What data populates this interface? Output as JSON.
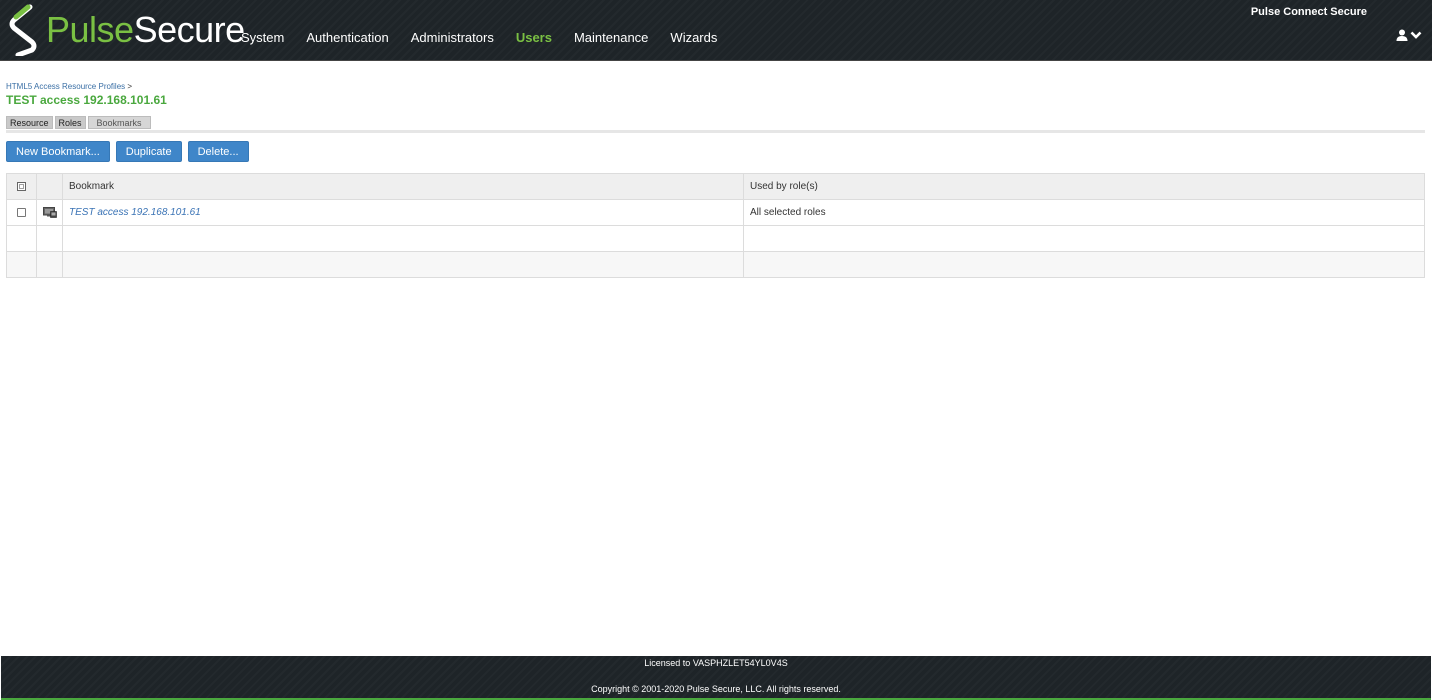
{
  "header": {
    "brand_pulse": "Pulse",
    "brand_secure": "Secure",
    "product_name": "Pulse Connect Secure",
    "nav": [
      {
        "label": "System"
      },
      {
        "label": "Authentication"
      },
      {
        "label": "Administrators"
      },
      {
        "label": "Users",
        "active": true
      },
      {
        "label": "Maintenance"
      },
      {
        "label": "Wizards"
      }
    ],
    "user_icon": "user-icon",
    "menu_icon": "chevron-down-icon"
  },
  "breadcrumb": {
    "link": "HTML5 Access Resource Profiles",
    "separator": ">"
  },
  "page_title": "TEST access 192.168.101.61",
  "tabs": [
    {
      "label": "Resource"
    },
    {
      "label": "Roles"
    },
    {
      "label": "Bookmarks",
      "active": true
    }
  ],
  "toolbar": {
    "new_bookmark": "New Bookmark...",
    "duplicate": "Duplicate",
    "delete": "Delete..."
  },
  "table": {
    "columns": {
      "bookmark": "Bookmark",
      "used_by": "Used by role(s)"
    },
    "rows": [
      {
        "bookmark": "TEST access 192.168.101.61",
        "used_by": "All selected roles",
        "icon": "html5-session-icon"
      }
    ]
  },
  "footer": {
    "license": "Licensed to VASPHZLET54YL0V4S",
    "copyright": "Copyright © 2001-2020 Pulse Secure, LLC. All rights reserved."
  },
  "colors": {
    "brand_green": "#7ac043",
    "title_green": "#4aa83e",
    "button_blue": "#3f86c9",
    "header_bg": "#1e2428"
  }
}
